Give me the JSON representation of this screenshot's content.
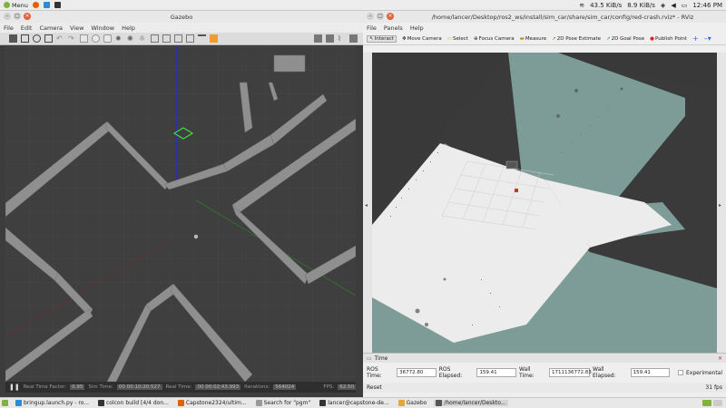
{
  "top_panel": {
    "menu_label": "Menu",
    "net_down": "43.5 KiB/s",
    "net_up": "8.9 KiB/s",
    "clock": "12:46 PM"
  },
  "gazebo": {
    "title": "Gazebo",
    "menu": [
      "File",
      "Edit",
      "Camera",
      "View",
      "Window",
      "Help"
    ],
    "status": {
      "rtf_label": "Real Time Factor:",
      "rtf_value": "0.95",
      "sim_time_label": "Sim Time:",
      "sim_time_value": "00 00:10:20.527",
      "real_time_label": "Real Time:",
      "real_time_value": "00 00:02:43.993",
      "iterations_label": "Iterations:",
      "iterations_value": "564024",
      "fps_label": "FPS:",
      "fps_value": "62.50"
    }
  },
  "rviz": {
    "title": "/home/lancer/Desktop/ros2_ws/install/sim_car/share/sim_car/config/red-crash.rviz* - RViz",
    "menu": [
      "File",
      "Panels",
      "Help"
    ],
    "tools": [
      "Interact",
      "Move Camera",
      "Select",
      "Focus Camera",
      "Measure",
      "2D Pose Estimate",
      "2D Goal Pose",
      "Publish Point"
    ],
    "time_panel": {
      "title": "Time",
      "ros_time_label": "ROS Time:",
      "ros_time_value": "36772.80",
      "ros_elapsed_label": "ROS Elapsed:",
      "ros_elapsed_value": "159.41",
      "wall_time_label": "Wall Time:",
      "wall_time_value": "1711136772.83",
      "wall_elapsed_label": "Wall Elapsed:",
      "wall_elapsed_value": "159.41",
      "experimental_label": "Experimental",
      "reset_label": "Reset",
      "fps": "31 fps"
    }
  },
  "taskbar": {
    "items": [
      "bringup.launch.py - ro...",
      "colcon build [4/4 don...",
      "Capstone2324/ultim...",
      "Search for \"pgm\"",
      "lancer@capstone-de...",
      "Gazebo",
      "/home/lancer/Deskto..."
    ]
  }
}
